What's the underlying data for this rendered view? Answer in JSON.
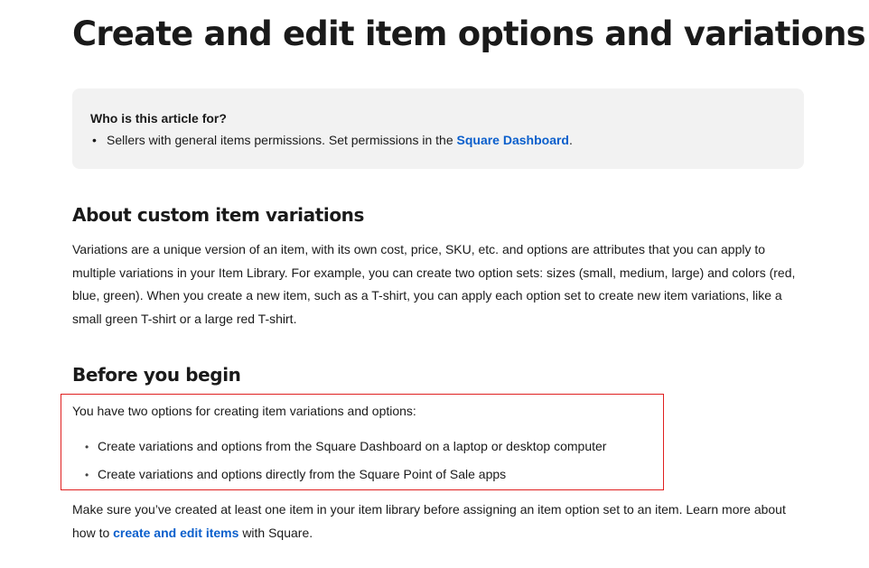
{
  "article": {
    "title": "Create and edit item options and variations",
    "audience": {
      "heading": "Who is this article for?",
      "bullet": "•",
      "text_before": "Sellers with general items permissions. Set permissions in the",
      "link": "Square Dashboard",
      "text_after": "."
    },
    "sections": [
      {
        "heading": "About custom item variations",
        "paragraph": "Variations are a unique version of an item, with its own cost, price, SKU, etc. and options are attributes that you can apply to multiple variations in your Item Library. For example, you can create two option sets: sizes (small, medium, large) and colors (red, blue, green). When you create a new item, such as a T-shirt, you can apply each option set to create new item variations, like a small green T-shirt or a large red T-shirt."
      },
      {
        "heading": "Before you begin",
        "intro": "You have two options for creating item variations and options:",
        "bullet": "•",
        "options": [
          "Create variations and options from the Square Dashboard on a laptop or desktop computer",
          "Create variations and options directly from the Square Point of Sale apps"
        ],
        "note_before": "Make sure you’ve created at least one item in your item library before assigning an item option set to an item. Learn more about how to",
        "note_link": "create and edit items",
        "note_after": "with Square."
      }
    ]
  },
  "colors": {
    "link": "#0b5fcc",
    "highlight_border": "#e02020",
    "callout_background": "#f2f2f2"
  }
}
